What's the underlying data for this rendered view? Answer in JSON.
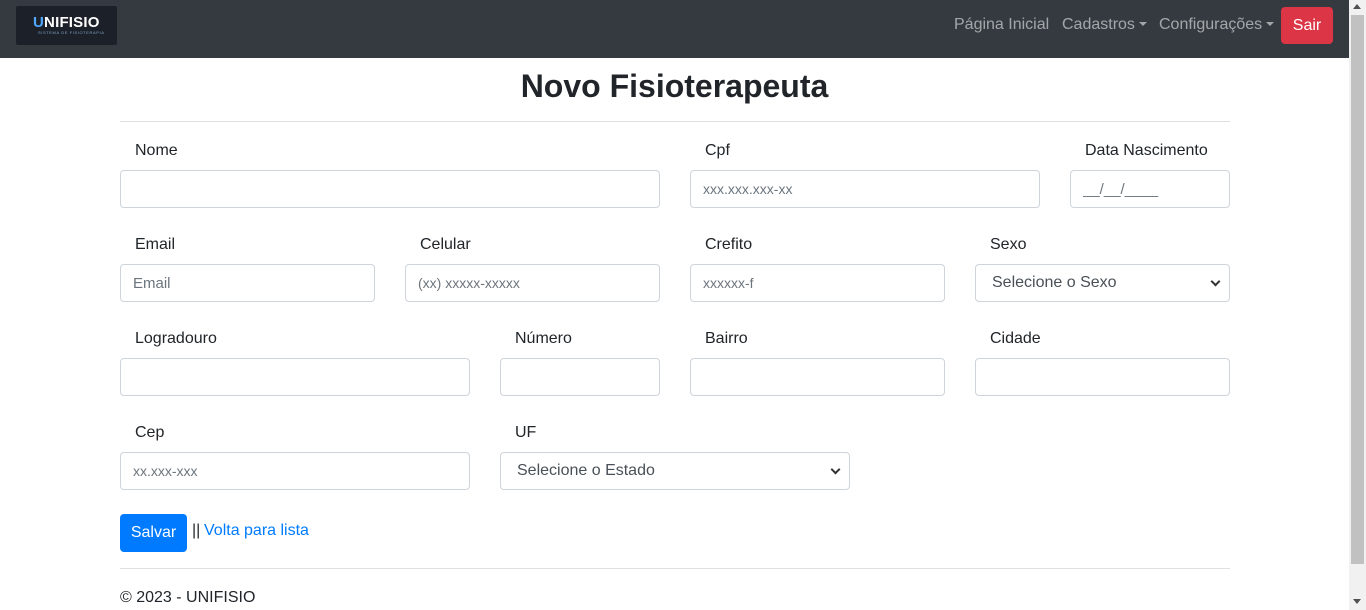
{
  "navbar": {
    "brand": {
      "name_accent": "U",
      "name_rest": "NIFISIO",
      "tagline": "SISTEMA DE FISIOTERAPIA"
    },
    "links": [
      {
        "label": "Página Inicial"
      },
      {
        "label": "Cadastros"
      },
      {
        "label": "Configurações"
      }
    ],
    "logout_label": "Sair"
  },
  "page": {
    "title": "Novo Fisioterapeuta"
  },
  "form": {
    "nome": {
      "label": "Nome",
      "value": "",
      "placeholder": ""
    },
    "cpf": {
      "label": "Cpf",
      "value": "",
      "placeholder": "xxx.xxx.xxx-xx"
    },
    "data_nascimento": {
      "label": "Data Nascimento",
      "value": "",
      "placeholder": "__/__/____"
    },
    "email": {
      "label": "Email",
      "value": "",
      "placeholder": "Email"
    },
    "celular": {
      "label": "Celular",
      "value": "",
      "placeholder": "(xx) xxxxx-xxxxx"
    },
    "crefito": {
      "label": "Crefito",
      "value": "",
      "placeholder": "xxxxxx-f"
    },
    "sexo": {
      "label": "Sexo",
      "selected": "Selecione o Sexo"
    },
    "logradouro": {
      "label": "Logradouro",
      "value": "",
      "placeholder": ""
    },
    "numero": {
      "label": "Número",
      "value": "",
      "placeholder": ""
    },
    "bairro": {
      "label": "Bairro",
      "value": "",
      "placeholder": ""
    },
    "cidade": {
      "label": "Cidade",
      "value": "",
      "placeholder": ""
    },
    "cep": {
      "label": "Cep",
      "value": "",
      "placeholder": "xx.xxx-xxx"
    },
    "uf": {
      "label": "UF",
      "selected": "Selecione o Estado"
    }
  },
  "actions": {
    "save_label": "Salvar",
    "separator": "||",
    "back_link": "Volta para lista"
  },
  "footer": {
    "text": "© 2023 - UNIFISIO"
  },
  "colors": {
    "navbar": "#343a40",
    "primary": "#007bff",
    "danger": "#dc3545"
  }
}
